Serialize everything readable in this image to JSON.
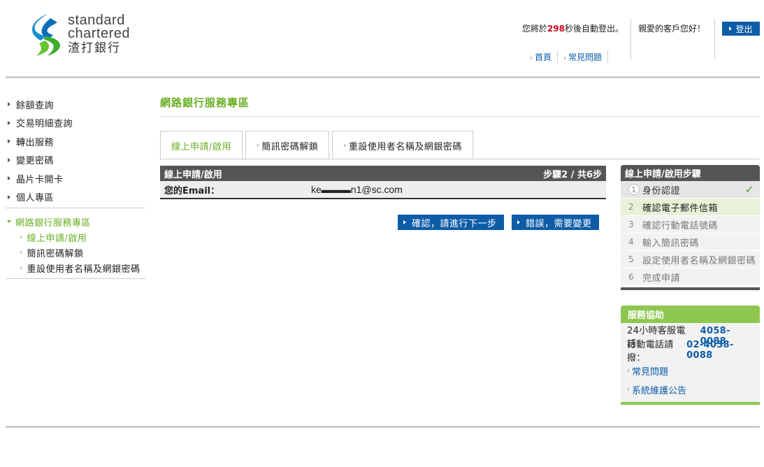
{
  "header": {
    "logo_line1": "standard",
    "logo_line2": "chartered",
    "logo_line3": "渣打銀行",
    "logout_prefix": "您將於",
    "logout_seconds": "298",
    "logout_suffix": "秒後自動登出。",
    "greeting": "親愛的客戶您好！",
    "logout_label": "登出",
    "links": [
      "首頁",
      "常見問題"
    ]
  },
  "sidebar": {
    "items": [
      "餘額查詢",
      "交易明細查詢",
      "轉出服務",
      "變更密碼",
      "晶片卡開卡",
      "個人專區"
    ],
    "active_section": "網路銀行服務專區",
    "sub_items": [
      "線上申請/啟用",
      "簡訊密碼解鎖",
      "重設使用者名稱及網銀密碼"
    ]
  },
  "main": {
    "page_title": "網路銀行服務專區",
    "tabs": [
      "線上申請/啟用",
      "簡訊密碼解鎖",
      "重設使用者名稱及網銀密碼"
    ],
    "form_title": "線上申請/啟用",
    "form_step": "步驟2 / 共6步",
    "email_label": "您的Email：",
    "email_value": "ke▬▬▬n1@sc.com",
    "btn_confirm": "確認，請進行下一步",
    "btn_error": "錯誤，需要變更"
  },
  "steps_panel": {
    "title": "線上申請/啟用步驟",
    "steps": [
      "身份認證",
      "確認電子郵件信箱",
      "確認行動電話號碼",
      "輸入簡訊密碼",
      "設定使用者名稱及網銀密碼",
      "完成申請"
    ],
    "numbers": [
      "1",
      "2",
      "3",
      "4",
      "5",
      "6"
    ],
    "check": "✓"
  },
  "help_panel": {
    "title": "服務協助",
    "hotline_label": "24小時客服電話：",
    "hotline": "4058-0088",
    "mobile_label": "行動電話請撥：",
    "mobile": "02-4058-0088",
    "links": [
      "常見問題",
      "系統維護公告"
    ]
  },
  "colors": {
    "brand_green": "#6ab023",
    "brand_blue": "#0d5ca8",
    "alert_red": "#d0021b",
    "help_green": "#8ec74f"
  }
}
